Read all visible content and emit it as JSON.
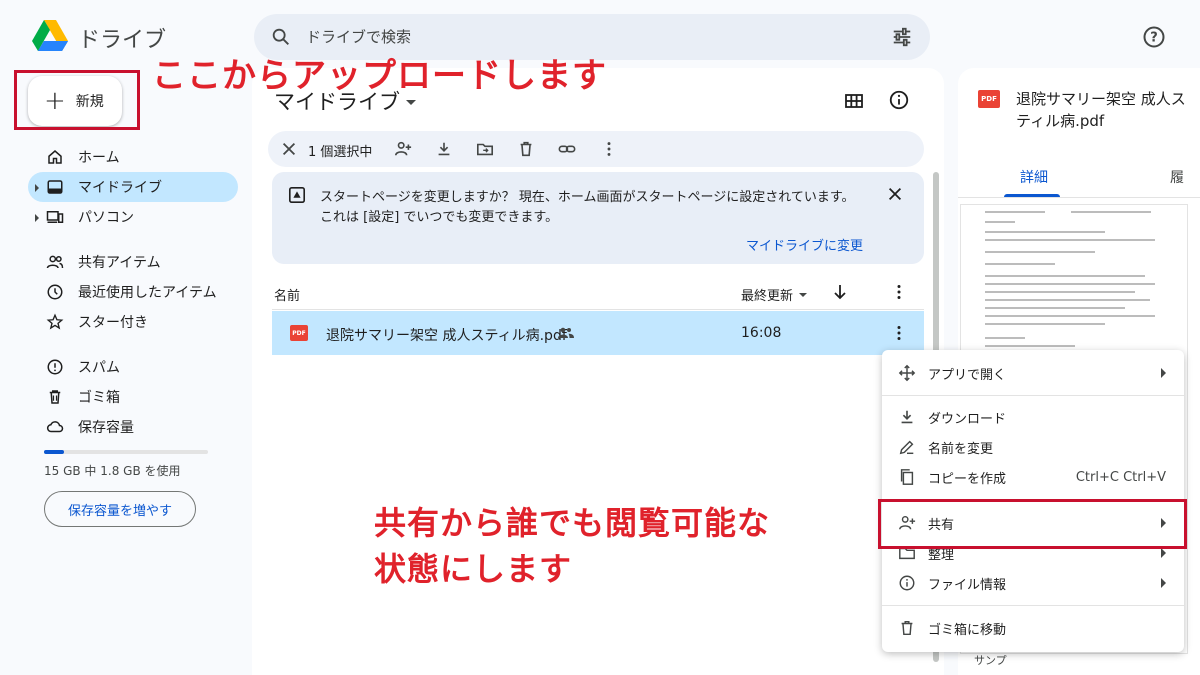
{
  "app": {
    "title": "ドライブ"
  },
  "search": {
    "placeholder": "ドライブで検索"
  },
  "sidebar": {
    "new_label": "新規",
    "items": [
      {
        "label": "ホーム",
        "icon": "home-icon"
      },
      {
        "label": "マイドライブ",
        "icon": "drive-icon",
        "active": true
      },
      {
        "label": "パソコン",
        "icon": "computer-icon"
      },
      {
        "label": "共有アイテム",
        "icon": "people-icon"
      },
      {
        "label": "最近使用したアイテム",
        "icon": "clock-icon"
      },
      {
        "label": "スター付き",
        "icon": "star-icon"
      },
      {
        "label": "スパム",
        "icon": "spam-icon"
      },
      {
        "label": "ゴミ箱",
        "icon": "trash-icon"
      },
      {
        "label": "保存容量",
        "icon": "cloud-icon"
      }
    ],
    "storage": {
      "used_fraction": 0.12,
      "text": "15 GB 中 1.8 GB を使用",
      "button": "保存容量を増やす"
    }
  },
  "main": {
    "title": "マイドライブ",
    "selection": {
      "count_text": "1 個選択中"
    },
    "banner": {
      "line1": "スタートページを変更しますか？ 現在、ホーム画面がスタートページに設定されています。",
      "line2": "これは [設定] でいつでも変更できます。",
      "link": "マイドライブに変更"
    },
    "columns": {
      "name": "名前",
      "modified": "最終更新"
    },
    "file": {
      "name": "退院サマリー架空 成人スティル病.pdf",
      "time": "16:08",
      "type_badge": "PDF"
    }
  },
  "details": {
    "title": "退院サマリー架空 成人スティル病.pdf",
    "tabs": [
      "詳細",
      "履"
    ],
    "bottom_text": "サンプ"
  },
  "context_menu": {
    "items": [
      {
        "label": "アプリで開く",
        "icon": "open-with-icon",
        "submenu": true
      },
      {
        "label": "ダウンロード",
        "icon": "download-icon"
      },
      {
        "label": "名前を変更",
        "icon": "rename-icon"
      },
      {
        "label": "コピーを作成",
        "icon": "copy-icon",
        "shortcut": "Ctrl+C Ctrl+V"
      },
      {
        "label": "共有",
        "icon": "share-icon",
        "submenu": true
      },
      {
        "label": "整理",
        "icon": "folder-icon",
        "submenu": true
      },
      {
        "label": "ファイル情報",
        "icon": "info-icon",
        "submenu": true
      },
      {
        "label": "ゴミ箱に移動",
        "icon": "trash-icon"
      }
    ]
  },
  "annotations": {
    "upload": "ここからアップロードします",
    "share_line1": "共有から誰でも閲覧可能な",
    "share_line2": "状態にします",
    "color": "#e0222b"
  }
}
